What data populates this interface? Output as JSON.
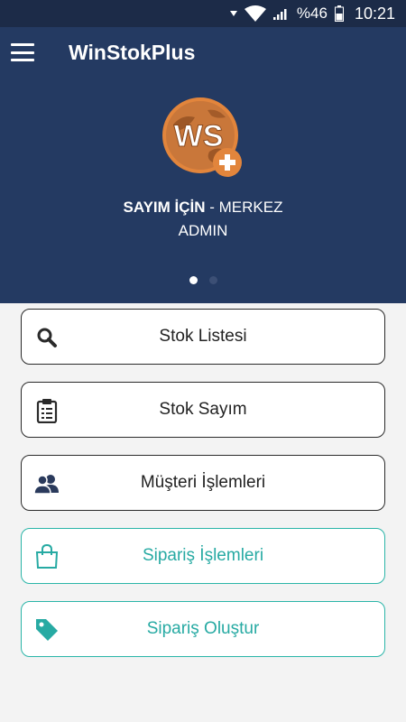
{
  "status_bar": {
    "battery": "%46",
    "time": "10:21"
  },
  "app_bar": {
    "title": "WinStokPlus",
    "menu_icon": "hamburger-menu-icon"
  },
  "header": {
    "logo_text": "WS",
    "company_name": "SAYIM İÇİN",
    "branch": " - MERKEZ",
    "user": "ADMIN",
    "pager": {
      "count": 2,
      "active": 0
    }
  },
  "menu": [
    {
      "label": "Stok Listesi",
      "icon": "search-icon"
    },
    {
      "label": "Stok Sayım",
      "icon": "clipboard-icon"
    },
    {
      "label": "Müşteri İşlemleri",
      "icon": "users-icon"
    },
    {
      "label": "Sipariş İşlemleri",
      "icon": "shopping-bag-icon"
    },
    {
      "label": "Sipariş Oluştur",
      "icon": "tag-icon"
    }
  ],
  "colors": {
    "primary": "#243a62",
    "accent": "#27aaa3",
    "logo": "#e2853c"
  }
}
